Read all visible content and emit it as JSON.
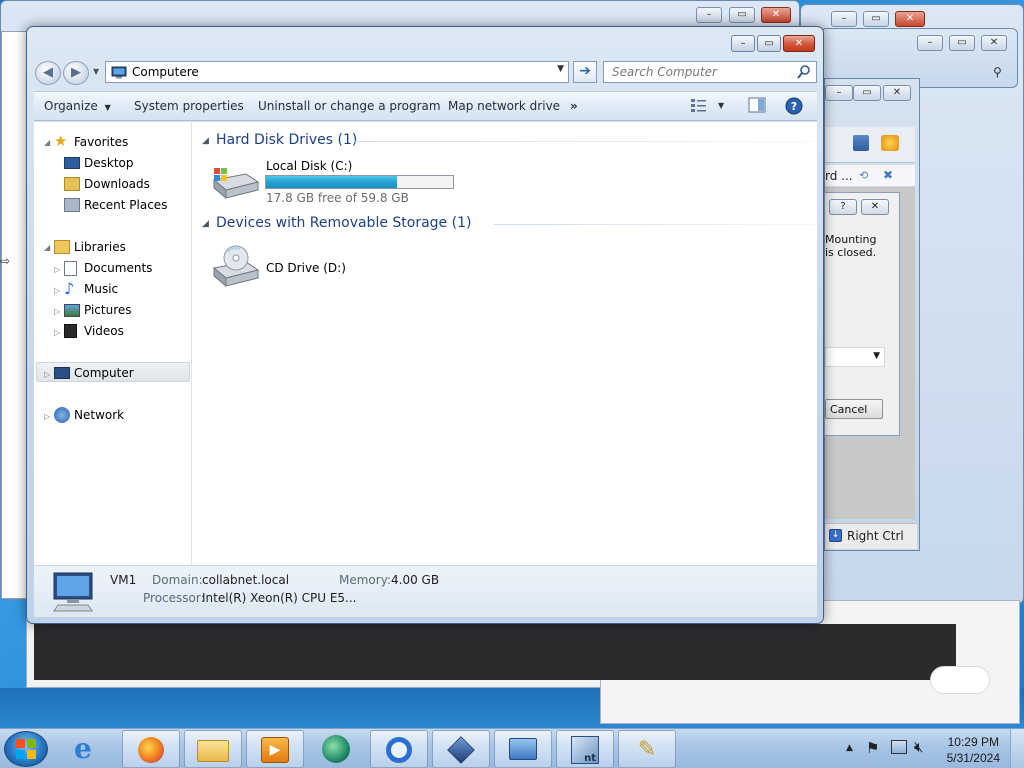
{
  "window": {
    "address": "Computere",
    "search_placeholder": "Search Computer"
  },
  "toolbar": {
    "organize": "Organize",
    "system_properties": "System properties",
    "uninstall": "Uninstall or change a program",
    "map_drive": "Map network drive",
    "more": "»"
  },
  "nav": {
    "favorites": "Favorites",
    "desktop": "Desktop",
    "downloads": "Downloads",
    "recent_places": "Recent Places",
    "libraries": "Libraries",
    "documents": "Documents",
    "music": "Music",
    "pictures": "Pictures",
    "videos": "Videos",
    "computer": "Computer",
    "network": "Network"
  },
  "groups": {
    "hdd_title": "Hard Disk Drives (1)",
    "removable_title": "Devices with Removable Storage (1)"
  },
  "drives": {
    "c_name": "Local Disk (C:)",
    "c_space": "17.8 GB free of 59.8 GB",
    "c_used_fraction": 0.702,
    "d_name": "CD Drive (D:)"
  },
  "details": {
    "name": "VM1",
    "domain_label": "Domain:",
    "domain_value": "collabnet.local",
    "memory_label": "Memory:",
    "memory_value": "4.00 GB",
    "processor_label": "Processor:",
    "processor_value": "Intel(R) Xeon(R) CPU E5..."
  },
  "background": {
    "dialog_text_1": "Mounting",
    "dialog_text_2": "is closed.",
    "dialog_cancel": "Cancel",
    "vb_title_frag": "rd ...",
    "host_key": "Right Ctrl",
    "frag_m": "m"
  },
  "clock": {
    "time": "10:29 PM",
    "date": "5/31/2024"
  },
  "colors": {
    "accent": "#1e3f8a",
    "progress": "#26a2d2",
    "close": "#c9452e"
  }
}
